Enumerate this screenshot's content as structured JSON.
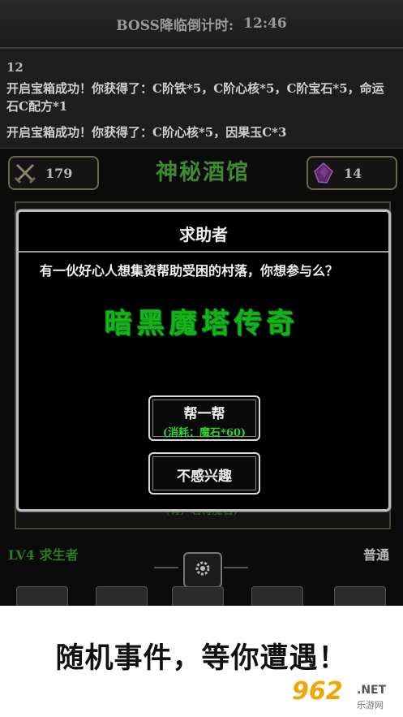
{
  "boss_bar": {
    "label": "BOSS降临倒计时:",
    "time": "12:46"
  },
  "log": {
    "count": "12",
    "line1": "开启宝箱成功！你获得了：C阶铁*5，C阶心核*5，C阶宝石*5，命运石C配方*1",
    "line2": "开启宝箱成功！你获得了：C阶心核*5，因果玉C*3"
  },
  "resources": {
    "left_value": "179",
    "right_value": "14",
    "left_icon": "crossed-swords-icon",
    "right_icon": "purple-crystal-icon"
  },
  "tavern": {
    "title": "神秘酒馆",
    "hint": "(有）若待魔石)"
  },
  "modal": {
    "title": "求助者",
    "message": "有一伙好心人想集资帮助受困的村落，你想参与么？",
    "watermark": "暗黑魔塔传奇",
    "help_button": {
      "label": "帮一帮",
      "cost": "(消耗：魔石*60)"
    },
    "decline_button": {
      "label": "不感兴趣"
    }
  },
  "footer": {
    "level": "LV4 求生者",
    "mode": "普通"
  },
  "promo": {
    "text": "随机事件，等你遭遇！",
    "logo_num": "962",
    "logo_net": ".NET",
    "logo_cn": "乐游网"
  },
  "colors": {
    "accent_green": "#2fd12f",
    "title_green": "#3f8a2e",
    "border_gold": "#6b6450"
  }
}
